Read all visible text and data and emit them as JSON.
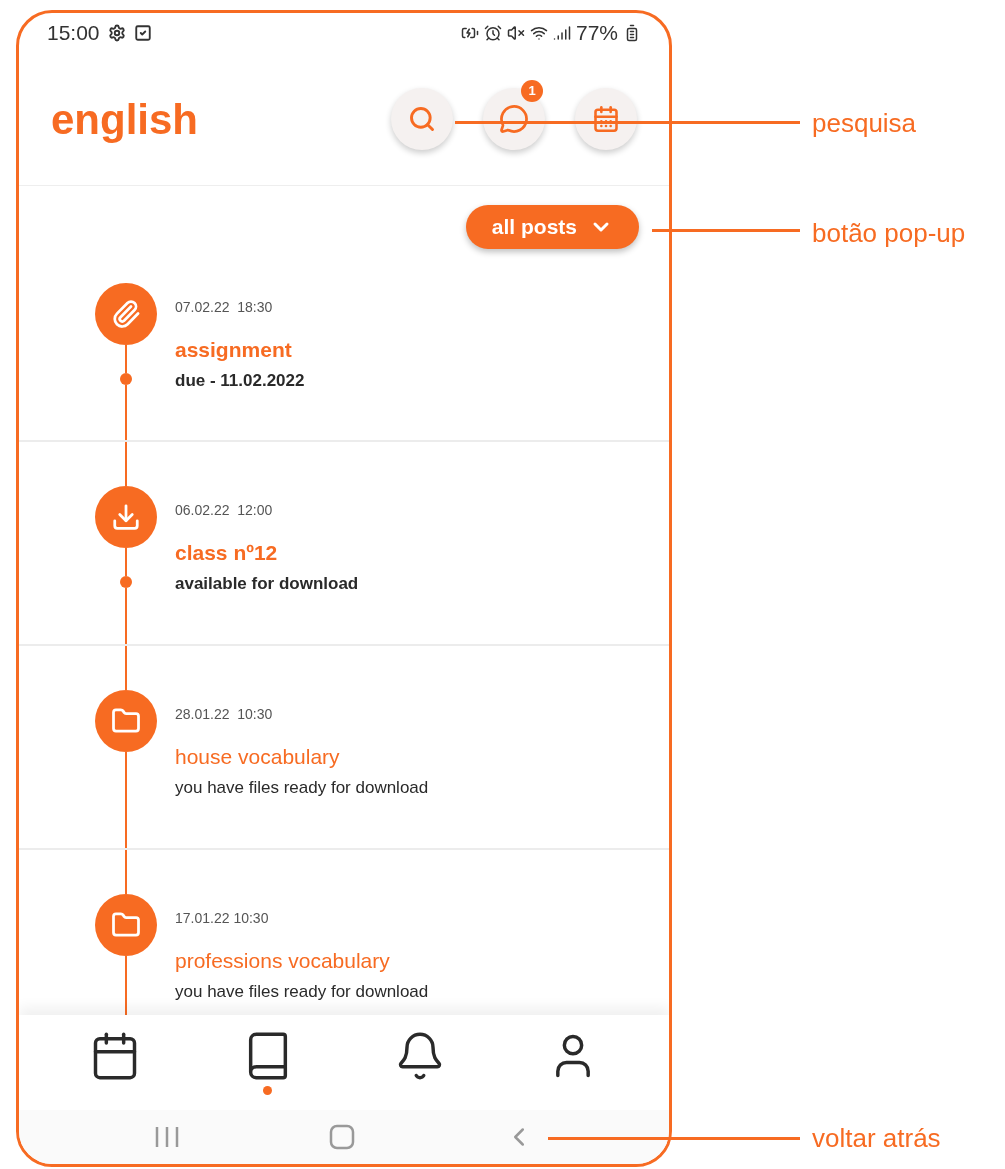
{
  "status_bar": {
    "time": "15:00",
    "battery": "77%"
  },
  "header": {
    "title": "english",
    "messages_badge": "1"
  },
  "filter": {
    "label": "all posts"
  },
  "posts": [
    {
      "kind": "attachment",
      "date": "07.02.22  18:30",
      "title": "assignment",
      "subtitle": "due - 11.02.2022",
      "unread": true
    },
    {
      "kind": "download",
      "date": "06.02.22  12:00",
      "title": "class nº12",
      "subtitle": "available for download",
      "unread": true
    },
    {
      "kind": "folder",
      "date": "28.01.22  10:30",
      "title": "house vocabulary",
      "subtitle": "you have files ready for download",
      "unread": false
    },
    {
      "kind": "folder",
      "date": "17.01.22 10:30",
      "title": "professions vocabulary",
      "subtitle": "you have files ready for download",
      "unread": false
    }
  ],
  "bottom_nav": [
    {
      "kind": "calendar",
      "selected": false
    },
    {
      "kind": "book",
      "selected": true
    },
    {
      "kind": "bell",
      "selected": false
    },
    {
      "kind": "user",
      "selected": false
    }
  ],
  "annotations": [
    {
      "kind": "search",
      "label": "pesquisa"
    },
    {
      "kind": "filter",
      "label": "botão pop-up"
    },
    {
      "kind": "back",
      "label": "voltar atrás"
    }
  ]
}
